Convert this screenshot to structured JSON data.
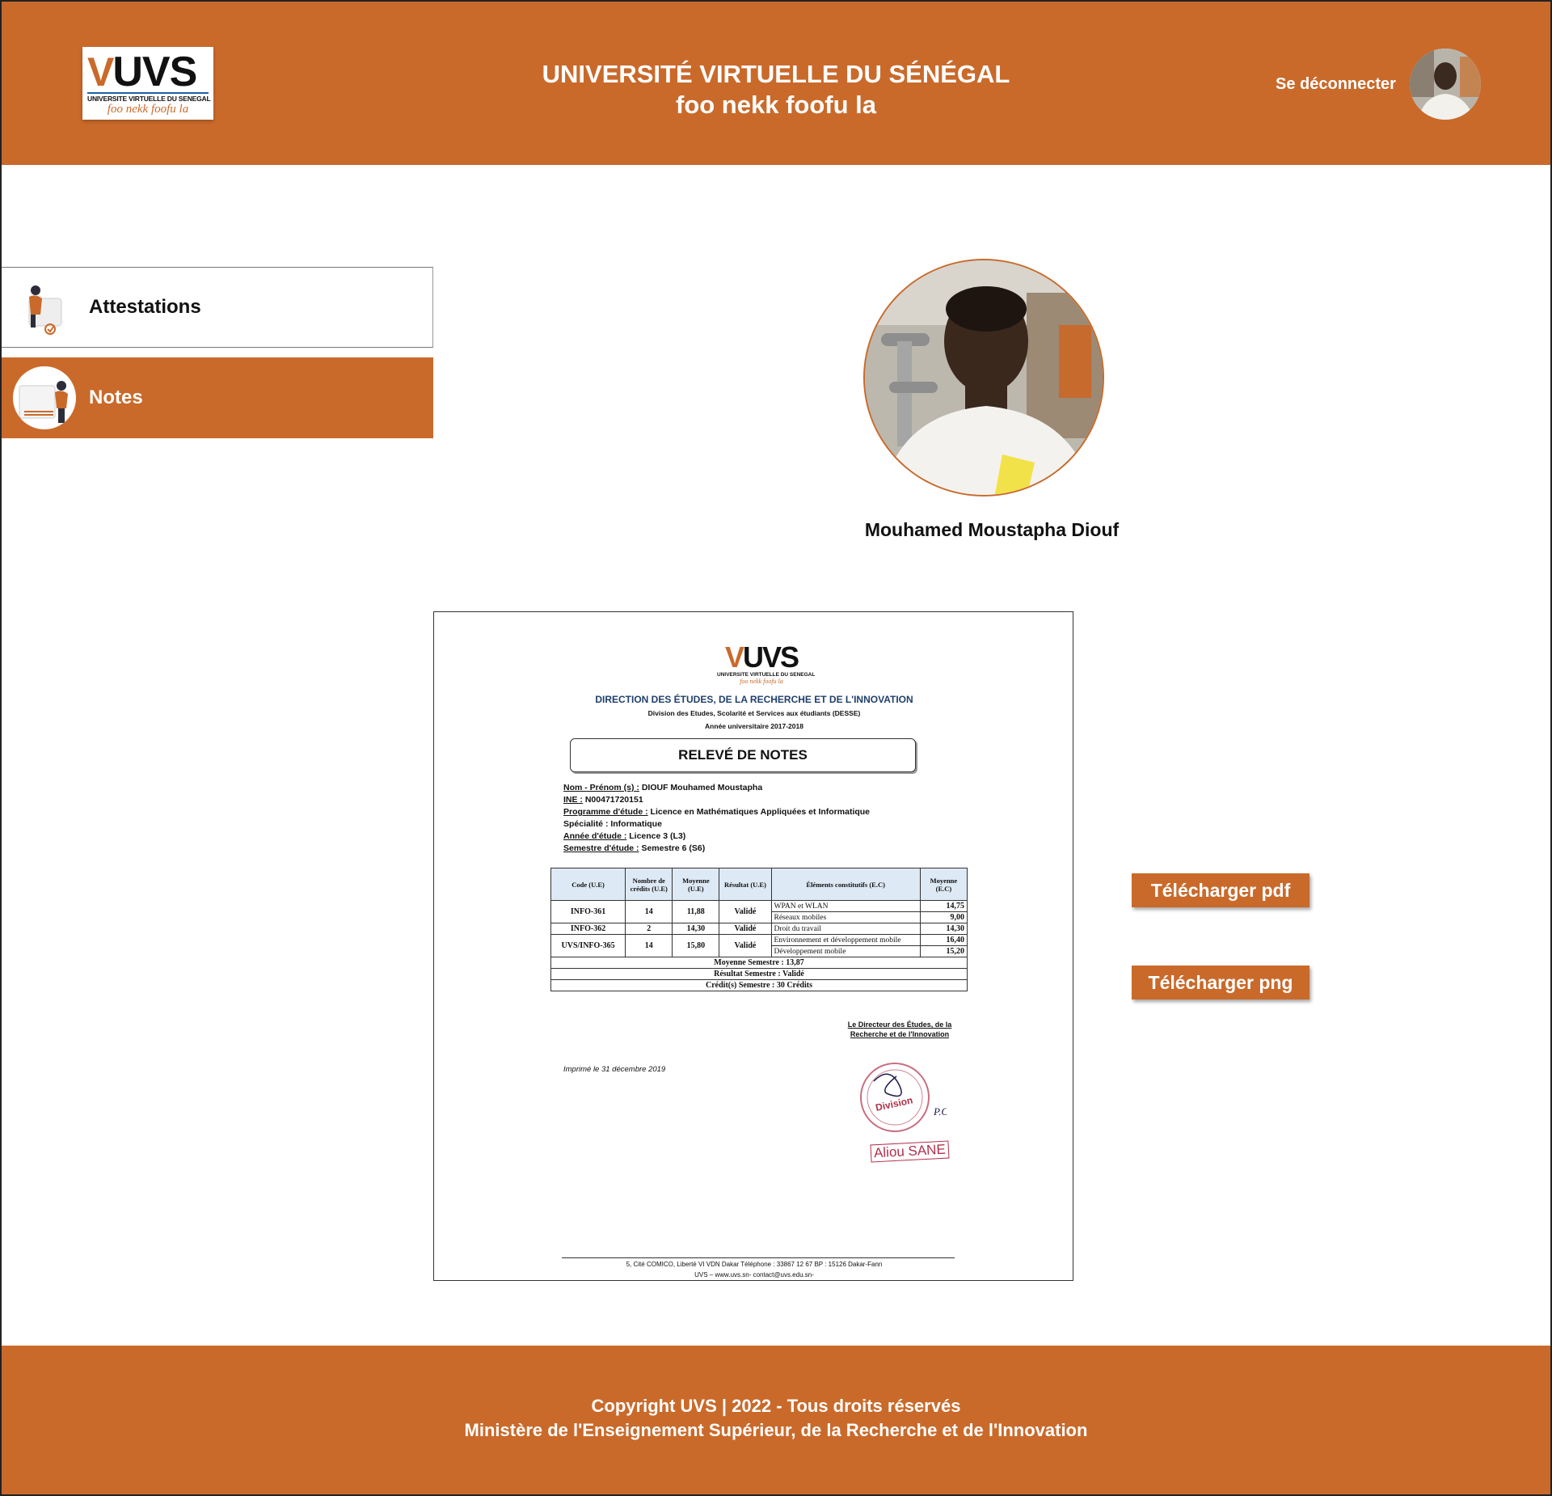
{
  "header": {
    "logo": {
      "text": "UVS",
      "subtitle": "UNIVERSITE VIRTUELLE DU SENEGAL",
      "motto": "foo nekk foofu la"
    },
    "title": "UNIVERSITÉ VIRTUELLE DU SÉNÉGAL",
    "subtitle": "foo nekk foofu la",
    "logout_label": "Se déconnecter"
  },
  "sidebar": {
    "items": [
      {
        "label": "Attestations",
        "active": false
      },
      {
        "label": "Notes",
        "active": true
      }
    ]
  },
  "profile": {
    "name": "Mouhamed Moustapha Diouf"
  },
  "document": {
    "logo_text": "UVS",
    "logo_subtitle": "UNIVERSITE VIRTUELLE DU SENEGAL",
    "logo_motto": "foo nekk foofu la",
    "direction": "DIRECTION DES ÉTUDES, DE LA RECHERCHE ET DE L'INNOVATION",
    "division": "Division des Etudes, Scolarité et Services aux étudiants (DESSE)",
    "year": "Année universitaire 2017-2018",
    "title": "RELEVÉ DE NOTES",
    "info": [
      {
        "key": "Nom - Prénom (s) :",
        "value": " DIOUF Mouhamed Moustapha"
      },
      {
        "key": "INE :",
        "value": " N00471720151"
      },
      {
        "key": "Programme d'étude :",
        "value": " Licence en Mathématiques Appliquées et Informatique"
      },
      {
        "key": "",
        "value": "Spécialité : Informatique"
      },
      {
        "key": "Année d'étude :",
        "value": " Licence 3 (L3)"
      },
      {
        "key": "Semestre d'étude :",
        "value": " Semestre 6 (S6)"
      }
    ],
    "table": {
      "headers": [
        "Code (U.E)",
        "Nombre de crédits (U.E)",
        "Moyenne (U.E)",
        "Résultat (U.E)",
        "Éléments constitutifs (E.C)",
        "Moyenne (E.C)"
      ],
      "rows": [
        {
          "code": "INFO-361",
          "credits": "14",
          "moyenne": "11,88",
          "resultat": "Validé",
          "ec": [
            {
              "name": "WPAN et WLAN",
              "moy": "14,75"
            },
            {
              "name": "Réseaux mobiles",
              "moy": "9,00"
            }
          ]
        },
        {
          "code": "INFO-362",
          "credits": "2",
          "moyenne": "14,30",
          "resultat": "Validé",
          "ec": [
            {
              "name": "Droit du travail",
              "moy": "14,30"
            }
          ]
        },
        {
          "code": "UVS/INFO-365",
          "credits": "14",
          "moyenne": "15,80",
          "resultat": "Validé",
          "ec": [
            {
              "name": "Environnement et développement mobile",
              "moy": "16,40"
            },
            {
              "name": "Développement mobile",
              "moy": "15,20"
            }
          ]
        }
      ],
      "summary": [
        "Moyenne Semestre : 13,87",
        "Résultat Semestre : Validé",
        "Crédit(s) Semestre : 30 Crédits"
      ]
    },
    "signatory_title": "Le Directeur des Études, de la Recherche et de l'Innovation",
    "printed": "Imprimé le 31 décembre 2019",
    "stamp_text": "Division",
    "stamp_initials": "P.O",
    "stamp_name": "Aliou SANE",
    "footer_address": "5, Cité COMICO, Liberté VI VDN Dakar Téléphone : 33867 12 67 BP : 15126 Dakar-Fann",
    "footer_contact": "UVS – www.uvs.sn- contact@uvs.edu.sn-"
  },
  "buttons": {
    "pdf": "Télécharger pdf",
    "png": "Télécharger png"
  },
  "footer": {
    "line1": "Copyright UVS | 2022 - Tous droits réservés",
    "line2": "Ministère de l'Enseignement Supérieur, de la Recherche et de l'Innovation"
  },
  "colors": {
    "brand": "#c96a2b",
    "white": "#ffffff",
    "text": "#111111"
  }
}
